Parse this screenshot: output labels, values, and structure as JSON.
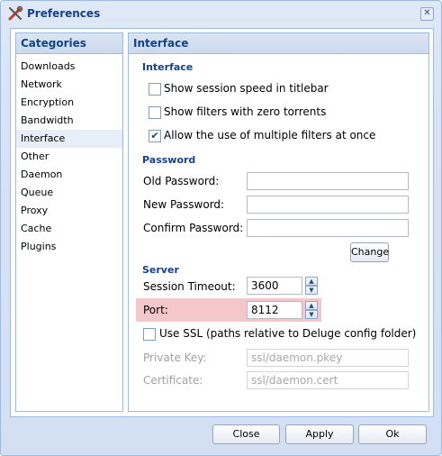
{
  "window": {
    "title": "Preferences",
    "close_glyph": "✕"
  },
  "categories": {
    "header": "Categories",
    "items": [
      "Downloads",
      "Network",
      "Encryption",
      "Bandwidth",
      "Interface",
      "Other",
      "Daemon",
      "Queue",
      "Proxy",
      "Cache",
      "Plugins"
    ],
    "selected": "Interface"
  },
  "interface_panel": {
    "header": "Interface",
    "interface_section": {
      "title": "Interface",
      "options": [
        {
          "label": "Show session speed in titlebar",
          "checked": false
        },
        {
          "label": "Show filters with zero torrents",
          "checked": false
        },
        {
          "label": "Allow the use of multiple filters at once",
          "checked": true
        }
      ]
    },
    "password_section": {
      "title": "Password",
      "old_label": "Old Password:",
      "old_value": "",
      "new_label": "New Password:",
      "new_value": "",
      "confirm_label": "Confirm Password:",
      "confirm_value": "",
      "change_button": "Change"
    },
    "server_section": {
      "title": "Server",
      "timeout_label": "Session Timeout:",
      "timeout_value": "3600",
      "port_label": "Port:",
      "port_value": "8112",
      "ssl_label": "Use SSL (paths relative to Deluge config folder)",
      "ssl_checked": false,
      "private_key_label": "Private Key:",
      "private_key_value": "ssl/daemon.pkey",
      "certificate_label": "Certificate:",
      "certificate_value": "ssl/daemon.cert"
    }
  },
  "footer": {
    "close": "Close",
    "apply": "Apply",
    "ok": "Ok"
  },
  "colors": {
    "accent": "#15428b",
    "border": "#99bbe8",
    "highlight": "#f4c7cb"
  },
  "icons": {
    "title": "tools-icon",
    "spinner_up": "▲",
    "spinner_down": "▼",
    "check": "✔"
  }
}
